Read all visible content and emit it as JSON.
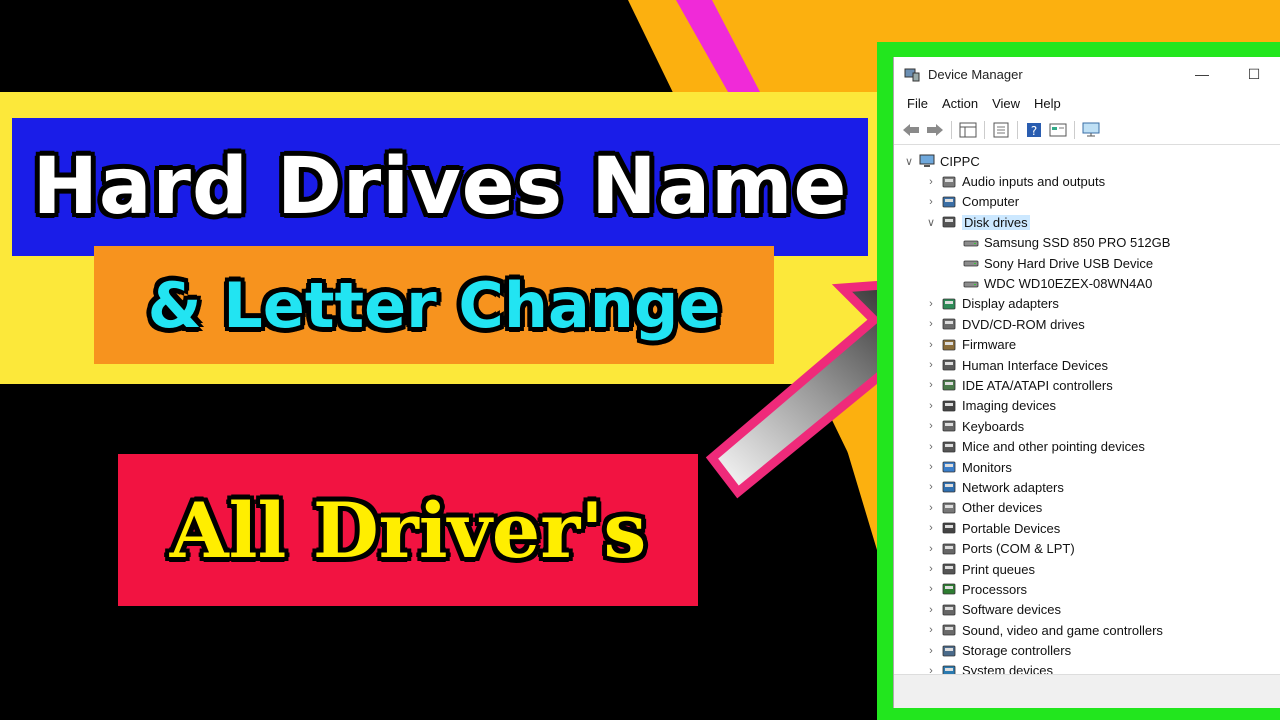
{
  "thumbnail": {
    "title_line1": "Hard Drives Name",
    "title_line2": "& Letter Change",
    "title_line3": "All Driver's",
    "colors": {
      "background": "#000000",
      "yellow_banner": "#fce83a",
      "blue_banner": "#1a1de8",
      "orange_banner": "#f7931e",
      "red_banner": "#f21341",
      "cyan_text": "#22e4f2",
      "yellow_text": "#ffee00",
      "green_frame": "#22e61e",
      "arrow_pink": "#ef2a7a"
    }
  },
  "window": {
    "title": "Device Manager",
    "app_icon": "device-manager-icon",
    "minimize_symbol": "—",
    "maximize_symbol": "☐",
    "menu": [
      "File",
      "Action",
      "View",
      "Help"
    ],
    "toolbar_icons": [
      "back-arrow-icon",
      "forward-arrow-icon",
      "properties-grid-icon",
      "details-icon",
      "help-icon",
      "console-icon",
      "monitor-icon"
    ]
  },
  "tree": {
    "root": "CIPPC",
    "categories": [
      {
        "label": "Audio inputs and outputs",
        "icon": "speaker-icon",
        "expanded": false
      },
      {
        "label": "Computer",
        "icon": "computer-icon",
        "expanded": false
      },
      {
        "label": "Disk drives",
        "icon": "disk-drive-icon",
        "expanded": true,
        "selected": true,
        "children": [
          "Samsung SSD 850 PRO 512GB",
          "Sony Hard Drive USB Device",
          "WDC WD10EZEX-08WN4A0"
        ]
      },
      {
        "label": "Display adapters",
        "icon": "display-adapter-icon",
        "expanded": false
      },
      {
        "label": "DVD/CD-ROM drives",
        "icon": "dvd-icon",
        "expanded": false
      },
      {
        "label": "Firmware",
        "icon": "firmware-icon",
        "expanded": false
      },
      {
        "label": "Human Interface Devices",
        "icon": "hid-icon",
        "expanded": false
      },
      {
        "label": "IDE ATA/ATAPI controllers",
        "icon": "ide-icon",
        "expanded": false
      },
      {
        "label": "Imaging devices",
        "icon": "camera-icon",
        "expanded": false
      },
      {
        "label": "Keyboards",
        "icon": "keyboard-icon",
        "expanded": false
      },
      {
        "label": "Mice and other pointing devices",
        "icon": "mouse-icon",
        "expanded": false
      },
      {
        "label": "Monitors",
        "icon": "monitor-icon",
        "expanded": false
      },
      {
        "label": "Network adapters",
        "icon": "network-icon",
        "expanded": false
      },
      {
        "label": "Other devices",
        "icon": "other-device-icon",
        "expanded": false
      },
      {
        "label": "Portable Devices",
        "icon": "portable-device-icon",
        "expanded": false
      },
      {
        "label": "Ports (COM & LPT)",
        "icon": "port-icon",
        "expanded": false
      },
      {
        "label": "Print queues",
        "icon": "printer-icon",
        "expanded": false
      },
      {
        "label": "Processors",
        "icon": "processor-icon",
        "expanded": false
      },
      {
        "label": "Software devices",
        "icon": "software-device-icon",
        "expanded": false
      },
      {
        "label": "Sound, video and game controllers",
        "icon": "sound-icon",
        "expanded": false
      },
      {
        "label": "Storage controllers",
        "icon": "storage-icon",
        "expanded": false
      },
      {
        "label": "System devices",
        "icon": "system-icon",
        "expanded": false
      }
    ]
  }
}
